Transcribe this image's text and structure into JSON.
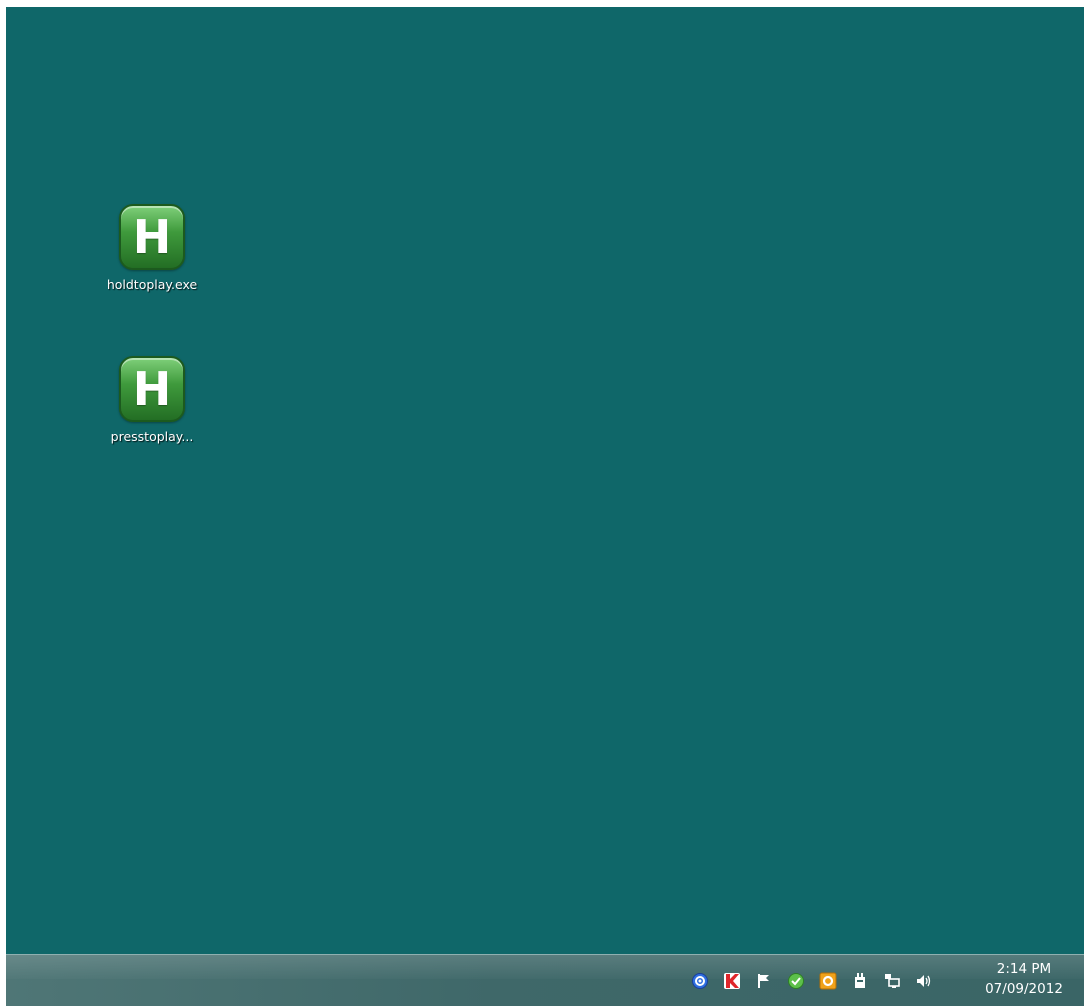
{
  "desktop": {
    "background_color": "#0f6769",
    "icons": [
      {
        "label": "holdtoplay.exe",
        "glyph": "H",
        "icon": "autohotkey-icon"
      },
      {
        "label": "presstoplay...",
        "glyph": "H",
        "icon": "autohotkey-icon"
      }
    ]
  },
  "taskbar": {
    "tray_icons": [
      {
        "name": "settings-gear-icon",
        "color": "#2f6fe0"
      },
      {
        "name": "kaspersky-icon",
        "color": "#e0262b"
      },
      {
        "name": "action-center-flag-icon",
        "color": "#ffffff"
      },
      {
        "name": "green-shield-icon",
        "color": "#5cc04a"
      },
      {
        "name": "outlook-icon",
        "color": "#f0a21a"
      },
      {
        "name": "power-plug-icon",
        "color": "#ffffff"
      },
      {
        "name": "network-icon",
        "color": "#ffffff"
      },
      {
        "name": "volume-icon",
        "color": "#ffffff"
      }
    ],
    "clock": {
      "time": "2:14 PM",
      "date": "07/09/2012"
    }
  }
}
